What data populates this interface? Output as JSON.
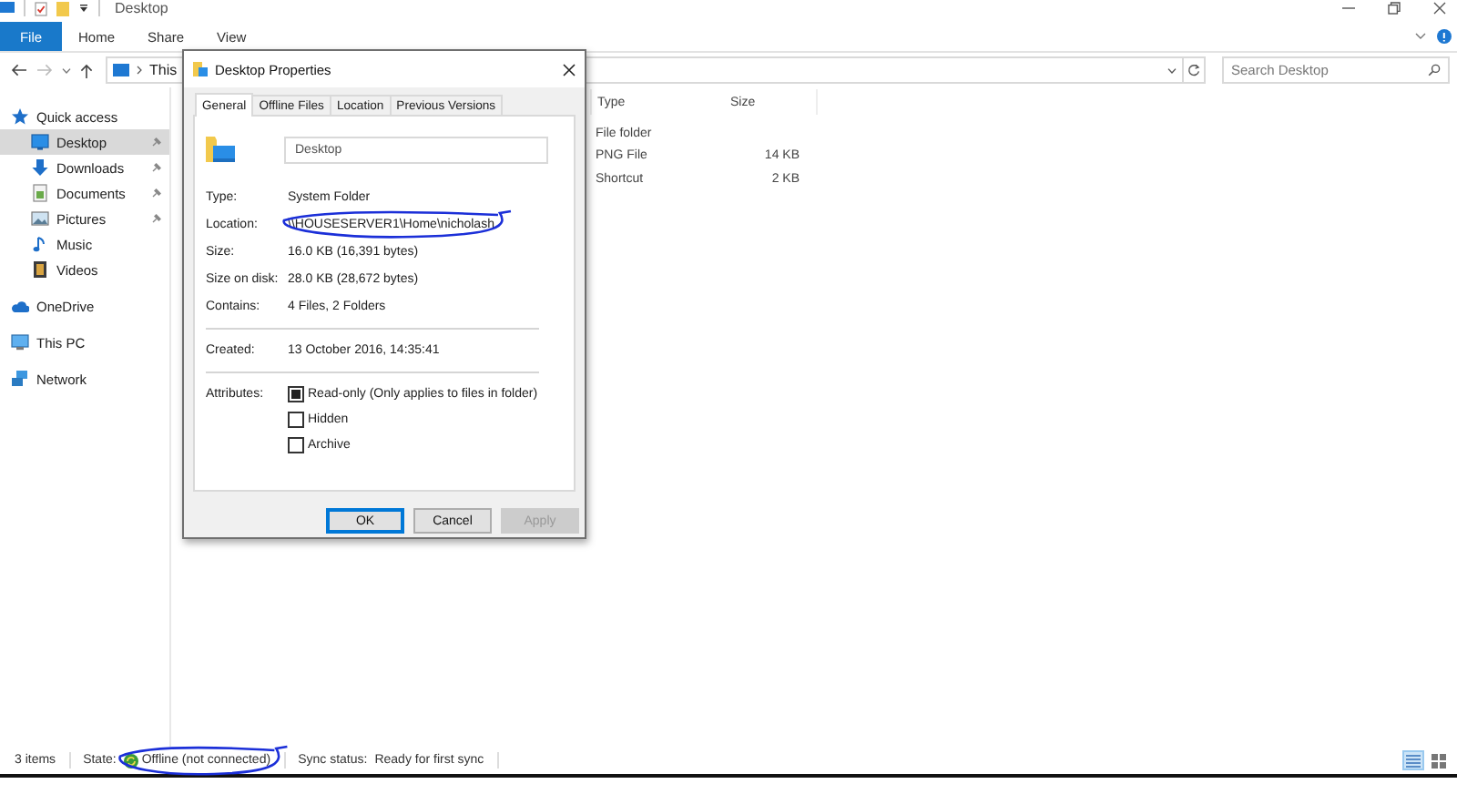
{
  "window": {
    "title": "Desktop"
  },
  "ribbon": {
    "tabs": [
      {
        "label": "File",
        "kind": "file",
        "selected": false
      },
      {
        "label": "Home",
        "kind": "tab",
        "selected": false
      },
      {
        "label": "Share",
        "kind": "tab",
        "selected": false
      },
      {
        "label": "View",
        "kind": "tab",
        "selected": false
      }
    ]
  },
  "address": {
    "breadcrumb": [
      "This"
    ]
  },
  "search": {
    "placeholder": "Search Desktop"
  },
  "navigation": [
    {
      "label": "Quick access",
      "kind": "star",
      "selected": false,
      "children": [
        {
          "label": "Desktop",
          "kind": "desktop",
          "selected": true,
          "pinned": true
        },
        {
          "label": "Downloads",
          "kind": "download",
          "selected": false,
          "pinned": true
        },
        {
          "label": "Documents",
          "kind": "documents",
          "selected": false,
          "pinned": true
        },
        {
          "label": "Pictures",
          "kind": "pictures",
          "selected": false,
          "pinned": true
        },
        {
          "label": "Music",
          "kind": "music",
          "selected": false,
          "pinned": false
        },
        {
          "label": "Videos",
          "kind": "videos",
          "selected": false,
          "pinned": false
        }
      ]
    },
    {
      "label": "OneDrive",
      "kind": "cloud",
      "selected": false
    },
    {
      "label": "This PC",
      "kind": "pc",
      "selected": false
    },
    {
      "label": "Network",
      "kind": "network",
      "selected": false
    }
  ],
  "file_list": {
    "columns": [
      "Type",
      "Size"
    ],
    "rows": [
      {
        "type": "File folder"
      },
      {
        "type": "PNG File",
        "size": "14 KB"
      },
      {
        "type": "Shortcut",
        "size": "2 KB"
      }
    ]
  },
  "dialog": {
    "title": "Desktop Properties",
    "tabs": [
      {
        "label": "General",
        "selected": true
      },
      {
        "label": "Offline Files",
        "selected": false
      },
      {
        "label": "Location",
        "selected": false
      },
      {
        "label": "Previous Versions",
        "selected": false
      }
    ],
    "name": "Desktop",
    "groups": [
      [
        {
          "label": "Type:",
          "value": "System Folder"
        },
        {
          "label": "Location:",
          "value": "\\\\HOUSESERVER1\\Home\\nicholash",
          "circled": true
        },
        {
          "label": "Size:",
          "value": "16.0 KB (16,391 bytes)"
        },
        {
          "label": "Size on disk:",
          "value": "28.0 KB (28,672 bytes)"
        },
        {
          "label": "Contains:",
          "value": "4 Files, 2 Folders"
        }
      ],
      [
        {
          "label": "Created:",
          "value": "13 October 2016, 14:35:41"
        }
      ]
    ],
    "attributes_label": "Attributes:",
    "attributes": [
      {
        "label": "Read-only (Only applies to files in folder)",
        "mixed": true
      },
      {
        "label": "Hidden",
        "checked": false
      },
      {
        "label": "Archive",
        "checked": false
      }
    ],
    "buttons": [
      {
        "label": "OK",
        "kind": "default"
      },
      {
        "label": "Cancel",
        "kind": "normal"
      },
      {
        "label": "Apply",
        "kind": "disabled"
      }
    ]
  },
  "status_bar": {
    "item_count": "3 items",
    "state_label": "State:",
    "state_value": "Offline (not connected)",
    "state_circled": true,
    "sync_label": "Sync status:",
    "sync_value": "Ready for first sync",
    "views": [
      {
        "kind": "details",
        "selected": true
      },
      {
        "kind": "tiles",
        "selected": false
      }
    ]
  }
}
